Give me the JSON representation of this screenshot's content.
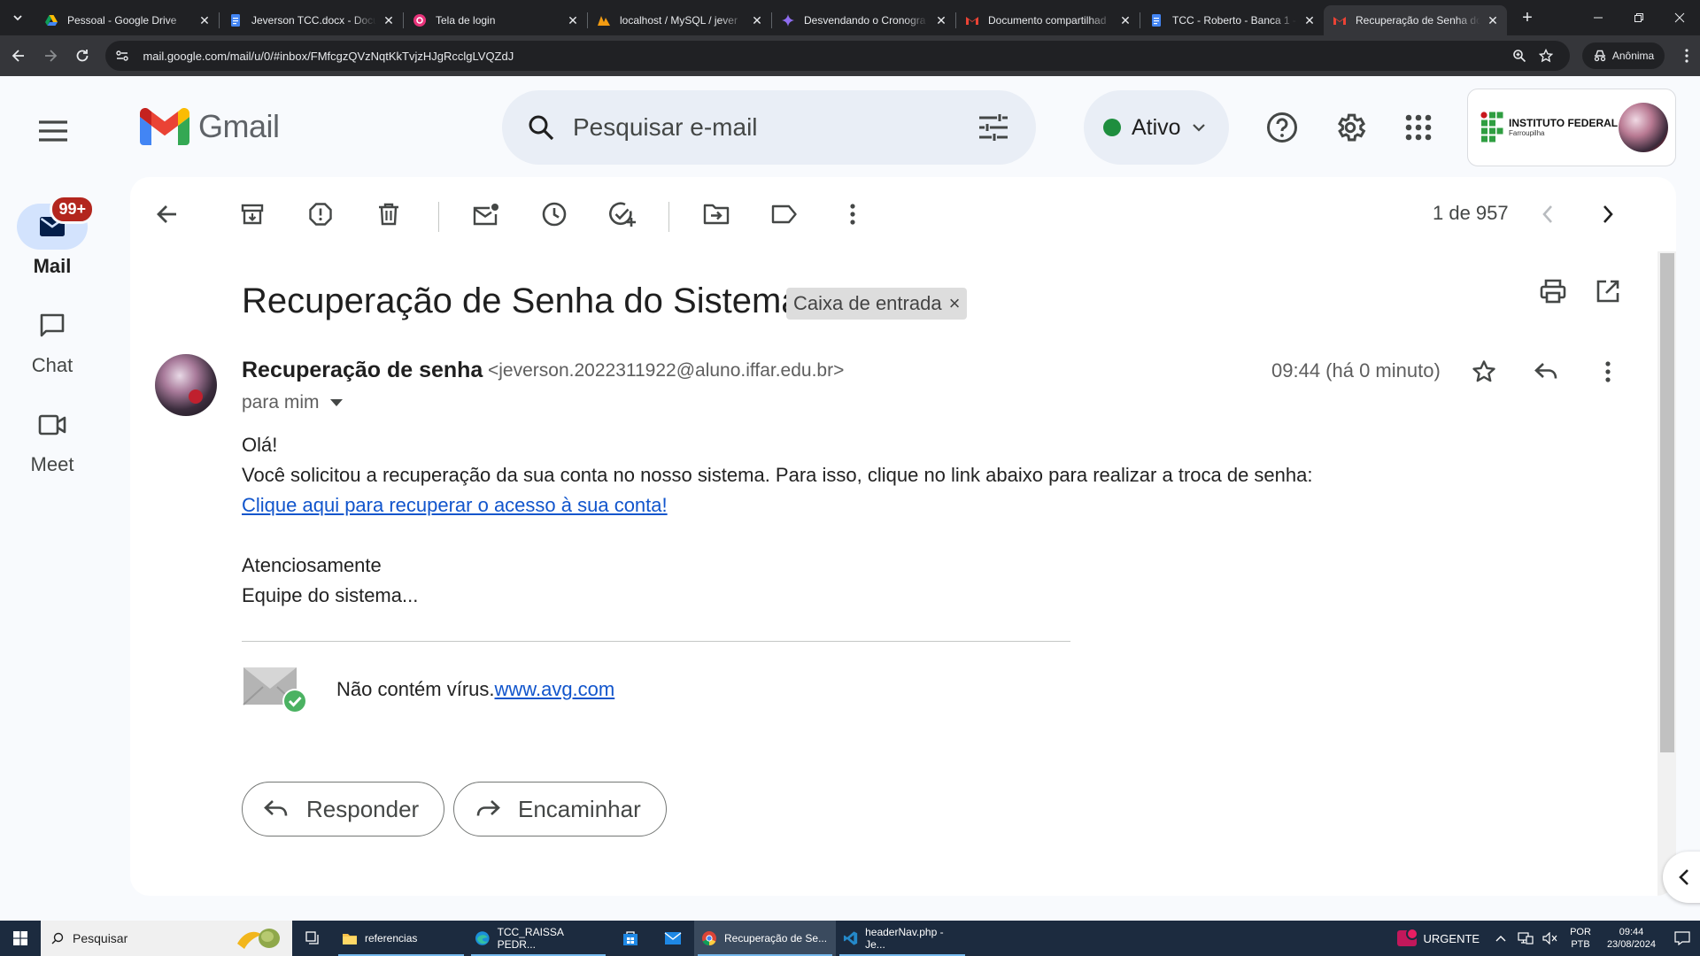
{
  "browser": {
    "tabs": [
      {
        "title": "Pessoal - Google Drive",
        "favicon": "google-drive-icon"
      },
      {
        "title": "Jeverson TCC.docx - Docu",
        "favicon": "google-docs-icon"
      },
      {
        "title": "Tela de login",
        "favicon": "figma-icon"
      },
      {
        "title": "localhost / MySQL / jever",
        "favicon": "phpmyadmin-icon"
      },
      {
        "title": "Desvendando o Cronogra",
        "favicon": "gemini-icon"
      },
      {
        "title": "Documento compartilhad",
        "favicon": "gmail-icon"
      },
      {
        "title": "TCC - Roberto - Banca 1 -",
        "favicon": "google-docs-icon"
      },
      {
        "title": "Recuperação de Senha do",
        "favicon": "gmail-icon"
      }
    ],
    "active_tab_index": 7,
    "url": "mail.google.com/mail/u/0/#inbox/FMfcgzQVzNqtKkTvjzHJgRcclgLVQZdJ",
    "incognito_label": "Anônima"
  },
  "gmail": {
    "logo_text": "Gmail",
    "search_placeholder": "Pesquisar e-mail",
    "status_label": "Ativo",
    "status_color": "#1e8e3e",
    "account_org_line1": "INSTITUTO FEDERAL",
    "account_org_line2": "Farroupilha"
  },
  "rail": {
    "items": [
      {
        "label": "Mail",
        "icon": "mail-icon",
        "badge": "99+",
        "active": true
      },
      {
        "label": "Chat",
        "icon": "chat-icon"
      },
      {
        "label": "Meet",
        "icon": "meet-icon"
      }
    ]
  },
  "message": {
    "pager": "1 de 957",
    "subject": "Recuperação de Senha do Sistema",
    "label_chip": "Caixa de entrada",
    "sender_name": "Recuperação de senha",
    "sender_email": "<jeverson.2022311922@aluno.iffar.edu.br>",
    "to": "para mim",
    "time": "09:44 (há 0 minuto)",
    "body": {
      "greeting": "Olá!",
      "line1": "Você solicitou a recuperação da sua conta no nosso sistema. Para isso, clique no link abaixo para realizar a troca de senha:",
      "link": "Clique aqui para recuperar o acesso à sua conta!",
      "closing": "Atenciosamente",
      "signature": "Equipe do sistema..."
    },
    "avg_text": "Não contém vírus.",
    "avg_link": "www.avg.com",
    "reply_label": "Responder",
    "forward_label": "Encaminhar"
  },
  "taskbar": {
    "search_placeholder": "Pesquisar",
    "apps": [
      {
        "label": "referencias",
        "icon": "folder-icon"
      },
      {
        "label": "TCC_RAISSA PEDR...",
        "icon": "edge-icon"
      },
      {
        "label": "Recuperação de Se...",
        "icon": "chrome-icon",
        "active": true
      },
      {
        "label": "headerNav.php - Je...",
        "icon": "vscode-icon"
      }
    ],
    "urgent_label": "URGENTE",
    "lang_line1": "POR",
    "lang_line2": "PTB",
    "clock_time": "09:44",
    "clock_date": "23/08/2024"
  }
}
